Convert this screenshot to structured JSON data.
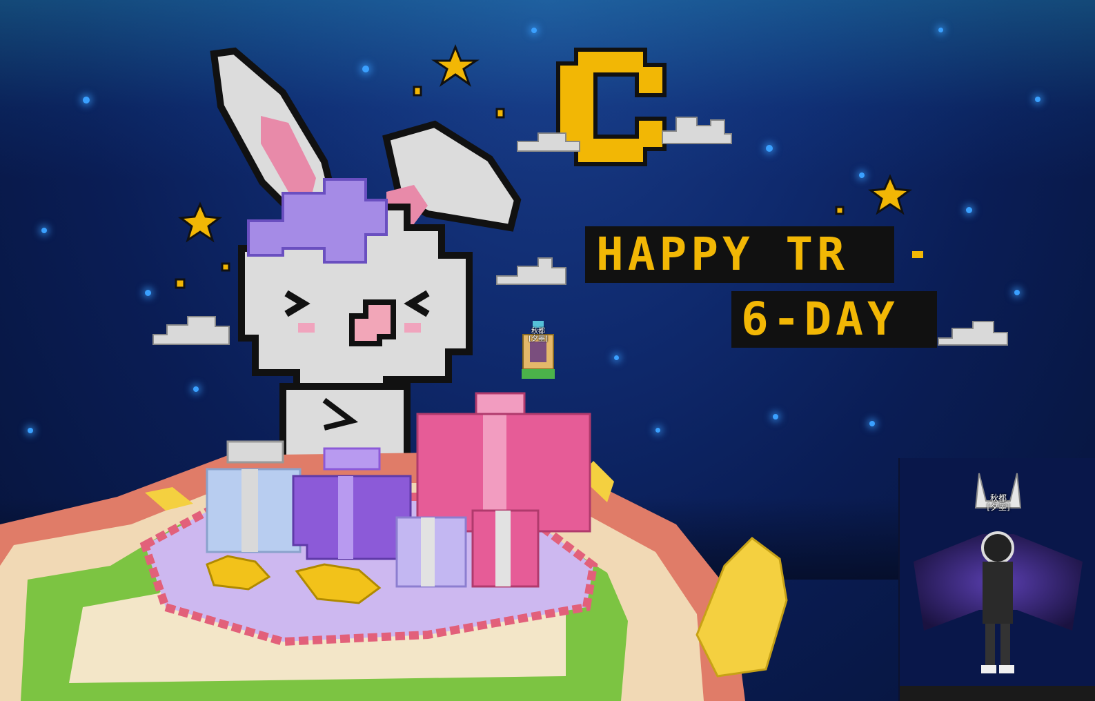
{
  "scene": {
    "background_color": "#0a1d55",
    "accent_yellow": "#f2b705",
    "banner_color": "#111111"
  },
  "banner": {
    "line1": "HAPPY TR",
    "line2": "6-DAY"
  },
  "player_character": {
    "name_tag": "秋都\n[夕墨]"
  },
  "profile_panel": {
    "name_tag": "秋都\n[夕墨]"
  }
}
